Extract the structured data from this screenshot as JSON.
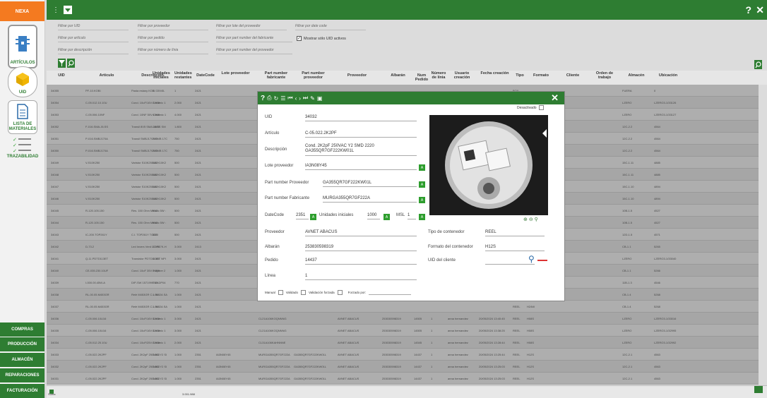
{
  "app": {
    "brand": "NEXA",
    "help": "?",
    "close": "✕"
  },
  "sidebar": {
    "articulos": "ARTÍCULOS",
    "uid": "UID",
    "lista": "LISTA DE MATERIALES",
    "traz": "TRAZABILIDAD",
    "bottom": [
      "COMPRAS",
      "PRODUCCIÓN",
      "ALMACÉN",
      "REPARACIONES",
      "FACTURACIÓN"
    ]
  },
  "filters": {
    "uid": "Filtrar por UID",
    "proveedor": "Filtrar por proveedor",
    "lote": "Filtrar por lote del proveedor",
    "datecode": "Filtrar por date code",
    "articulo": "Filtrar por artículo",
    "pedido": "Filtrar por pedido",
    "pn_fab": "Filtrar por part number del fabricante",
    "mostrar": "Mostrar sólo UID activos",
    "descripcion": "Filtrar por descripción",
    "linea": "Filtrar por número de línia",
    "pn_prov": "Filtrar por part number del proveedor"
  },
  "columns": [
    "UID",
    "Artículo",
    "Descripción",
    "Unidades Iniciales",
    "Unidades restantes",
    "DateCode",
    "Lote proveedor",
    "Part number fabricante",
    "Part number proveedor",
    "Proveedor",
    "Albarán",
    "Num Pedido",
    "Número de línia",
    "Usuario creación",
    "Fecha creación",
    "Tipo",
    "Formato",
    "Cliente",
    "Orden de trabajo",
    "Almacén",
    "Ubicación"
  ],
  "rows": [
    [
      "34055",
      "PF-10.KOBI",
      "Pasta estany KOBI 33945-",
      "1",
      "1",
      "2421",
      "",
      "",
      "",
      "",
      "",
      "",
      "",
      "",
      "",
      "BOX",
      "",
      "",
      "",
      "FUERA",
      "0"
    ],
    [
      "34054",
      "C-05.012.10.10U",
      "Cond. 10uF/16V Cerámic 1",
      "2.000",
      "2.000",
      "2421",
      "",
      "",
      "",
      "",
      "",
      "",
      "",
      "",
      "",
      "REEL",
      "H08S",
      "",
      "",
      "LZERO",
      "LZERO3-1/33126"
    ],
    [
      "34053",
      "C-05.006.10NF",
      "Cond. 10NF 50V Cerámic 1",
      "4.000",
      "4.000",
      "2421",
      "",
      "",
      "",
      "",
      "",
      "",
      "",
      "",
      "",
      "REEL",
      "H08S",
      "",
      "",
      "LZERO",
      "LZERO3-1/33127"
    ],
    [
      "34052",
      "F-016.SMA.J6.SS",
      "Transil 8V5 SMA J6.SS SM",
      "1.800",
      "1.800",
      "2421",
      "",
      "",
      "",
      "",
      "",
      "",
      "",
      "",
      "",
      "REEL",
      "H12S",
      "",
      "",
      "12C-2.2",
      "4564"
    ],
    [
      "34051",
      "P-016.SMBJ170A",
      "Transil SMBJ170A SMB 17C",
      "750",
      "750",
      "2421",
      "",
      "",
      "",
      "",
      "",
      "",
      "",
      "",
      "",
      "REEL",
      "H12W",
      "",
      "",
      "12C-2.2",
      "4564"
    ],
    [
      "34050",
      "P-016.SMBJ170A",
      "Transil SMBJ170A SMB 17C",
      "750",
      "750",
      "2421",
      "",
      "",
      "",
      "",
      "",
      "",
      "",
      "",
      "",
      "REEL",
      "H12W",
      "",
      "",
      "12C-2.2",
      "4564"
    ],
    [
      "34049",
      "V-S10K250",
      "Varistor S10K250 AVX10K2",
      "500",
      "500",
      "2421",
      "",
      "",
      "",
      "",
      "",
      "",
      "",
      "",
      "",
      "BOX",
      "",
      "",
      "",
      "15C-1.11",
      "4885"
    ],
    [
      "34048",
      "V-S10K250",
      "Varistor S10K250 AVX10K2",
      "500",
      "500",
      "2421",
      "",
      "",
      "",
      "",
      "",
      "",
      "",
      "",
      "",
      "BOX",
      "",
      "",
      "",
      "15C-1.11",
      "4885"
    ],
    [
      "34047",
      "V-S10K250",
      "Varistor S10K250 AVX10K2",
      "500",
      "500",
      "2421",
      "",
      "",
      "",
      "",
      "",
      "",
      "",
      "",
      "",
      "BOX",
      "",
      "",
      "",
      "15C-1.10",
      "4894"
    ],
    [
      "34046",
      "V-S10K250",
      "Varistor S10K250 AVX10K2",
      "500",
      "500",
      "2421",
      "",
      "",
      "",
      "",
      "",
      "",
      "",
      "",
      "",
      "BOX",
      "",
      "",
      "",
      "15C-1.10",
      "4894"
    ],
    [
      "34045",
      "R-120.105.150",
      "Res. 150 Ohm Metalic 5W :",
      "500",
      "500",
      "2421",
      "",
      "",
      "",
      "",
      "",
      "",
      "",
      "",
      "",
      "BOX",
      "",
      "",
      "",
      "10B-1.5",
      "4527"
    ],
    [
      "34044",
      "R-120.105.150",
      "Res. 150 Ohm Metalic 5W :",
      "500",
      "500",
      "2421",
      "",
      "",
      "",
      "",
      "",
      "",
      "",
      "",
      "",
      "BOX",
      "",
      "",
      "",
      "10B-1.5",
      "4527"
    ],
    [
      "34043",
      "IC-200.TOP261Y",
      "C.I. TOP261Y TO220",
      "500",
      "500",
      "2421",
      "",
      "",
      "",
      "",
      "",
      "",
      "",
      "",
      "",
      "STICK",
      "",
      "",
      "",
      "12D-1.5",
      "4571"
    ],
    [
      "34042",
      "D-73.2",
      "Led Invers Verd LG P47K-H",
      "3.000",
      "3.000",
      "2413",
      "",
      "",
      "",
      "",
      "",
      "",
      "",
      "",
      "",
      "REEL",
      "H08S",
      "",
      "",
      "CB-1.1",
      "5265"
    ],
    [
      "34041",
      "Q-11.PDTD113ET",
      "Transistor PDTD113ET NPI",
      "3.000",
      "3.000",
      "2421",
      "",
      "",
      "",
      "",
      "",
      "",
      "",
      "",
      "",
      "REEL",
      "H08S",
      "",
      "",
      "LZERO",
      "LZERO3-1/33040"
    ],
    [
      "34040",
      "CE-035.230.10UF",
      "Cond. 10uF 35V Polymer 2",
      "1.000",
      "1.000",
      "2421",
      "",
      "",
      "",
      "",
      "",
      "",
      "",
      "",
      "",
      "REEL",
      "H08S",
      "",
      "",
      "CB-1.1",
      "5266"
    ],
    [
      "34039",
      "I-000.00.45W-A",
      "DIP-SW 1571999-6/ADP04",
      "770",
      "770",
      "2421",
      "",
      "",
      "",
      "",
      "",
      "",
      "",
      "",
      "",
      "STICK",
      "",
      "",
      "",
      "11B-1.3",
      "4546"
    ],
    [
      "34038",
      "RL-00.05.M453GR",
      "Relé M453GR C.I. 5V 2A SA",
      "1.000",
      "1.000",
      "2421",
      "",
      "",
      "",
      "",
      "",
      "",
      "",
      "",
      "",
      "REEL",
      "H24W",
      "",
      "",
      "CB-1.4",
      "5268"
    ],
    [
      "34037",
      "RL-00.05.M453GR",
      "Relé M453GR C.I. 5V 2A SA",
      "1.000",
      "1.000",
      "2421",
      "",
      "",
      "",
      "",
      "",
      "",
      "",
      "",
      "",
      "REEL",
      "H24W",
      "",
      "",
      "CB-1.4",
      "5268"
    ],
    [
      "34036",
      "C-05.006.10U16",
      "Cond. 10uF/16V Cerámic 1",
      "3.000",
      "3.000",
      "2421",
      "",
      "CL21A106KOQNNNG",
      "",
      "AVNET ABACUS",
      "253030598319",
      "14505",
      "1",
      "anna hernandez",
      "20/05/2024 13:40:45",
      "REEL",
      "H08S",
      "",
      "",
      "LZERO",
      "LZERO3-1/33016"
    ],
    [
      "34035",
      "C-05.006.10U16",
      "Cond. 10uF/16V Cerámic 1",
      "3.000",
      "3.000",
      "2421",
      "",
      "CL21A106KOQNNNG",
      "",
      "AVNET ABACUS",
      "253030598319",
      "14505",
      "1",
      "anna hernandez",
      "20/05/2024 13:38:25",
      "REEL",
      "H08S",
      "",
      "",
      "LZERO",
      "LZERO3-1/32995"
    ],
    [
      "34034",
      "C-05.012.25.10U",
      "Cond. 10uF/25V Cerámic 1",
      "2.000",
      "2.000",
      "2421",
      "",
      "CL31A106KAHNNNE",
      "",
      "AVNET ABACUS",
      "253030598319",
      "14545",
      "1",
      "anna hernandez",
      "20/05/2024 13:28:44",
      "REEL",
      "H08S",
      "",
      "",
      "LZERO",
      "LZERO3-1/32992"
    ],
    [
      "34033",
      "C-05.022.2K2PF",
      "Cond. 2K2pF 250VAC Y2 SI",
      "1.000",
      "1.000",
      "2351",
      "IA3N08Y45",
      "MURGA355QR7GF222A",
      "GA355QR7GF222KW01L",
      "AVNET ABACUS",
      "253030598319",
      "14437",
      "1",
      "anna hernandez",
      "20/05/2024 13:25:44",
      "REEL",
      "H12S",
      "",
      "",
      "12C-2.1",
      "4563"
    ],
    [
      "34032",
      "C-05.022.2K2PF",
      "Cond. 2K2pF 250VAC Y2 SI",
      "1.000",
      "1.000",
      "2351",
      "IA3N08Y45",
      "MURGA355QR7GF222A",
      "GA355QR7GF222KW01L",
      "AVNET ABACUS",
      "253030598319",
      "14437",
      "1",
      "anna hernandez",
      "20/05/2024 13:25:03",
      "REEL",
      "H12S",
      "",
      "",
      "12C-2.1",
      "4563"
    ],
    [
      "34031",
      "C-05.022.2K2PF",
      "Cond. 2K2pF 250VAC Y2 SI",
      "1.000",
      "1.000",
      "2351",
      "IA3N08Y45",
      "MURGA355QR7GF222A",
      "GA355QR7GF222KW01L",
      "AVNET ABACUS",
      "253030598319",
      "14437",
      "1",
      "anna hernandez",
      "20/05/2024 13:25:03",
      "REEL",
      "H12S",
      "",
      "",
      "12C-2.1",
      "4563"
    ],
    [
      "34030",
      "CN-500.006.06/Q.ST",
      "Conector 06/Q.ST (ST 6 pi",
      "500",
      "500",
      "2421",
      "",
      "06/Q.ST",
      "",
      "JST ESPAÑOL S.A.",
      "A1/132.829",
      "14517",
      "9",
      "anna hernandez",
      "20/05/2024 13:20:17",
      "BOX",
      "",
      "",
      "",
      "16A-1.4",
      "5276"
    ]
  ],
  "modal": {
    "desactivado": "Desactivado",
    "uid_label": "UID",
    "uid": "34032",
    "articulo_label": "Artículo",
    "articulo": "C-05.022.2K2PF",
    "descripcion_label": "Descripción",
    "descripcion": "Cond. 2K2pF 250VAC Y2 SMD 2220 GA355QR7GF222KW01L",
    "lote_label": "Lote proveedor",
    "lote": "IA3N08Y45",
    "pnprov_label": "Part number Proveedor",
    "pnprov": "GA355QR7GF222KW01L",
    "pnfab_label": "Part number Fabricante",
    "pnfab": "MURGA355QR7GF222A",
    "datecode_label": "DateCode",
    "datecode": "2351",
    "uinic_label": "Unidades iniciales",
    "uinic": "1000",
    "msl_label": "MSL",
    "msl": "1",
    "proveedor_label": "Proveedor",
    "proveedor": "AVNET ABACUS",
    "albaran_label": "Albarán",
    "albaran": "253830598319",
    "pedido_label": "Pedido",
    "pedido": "14437",
    "linea_label": "Línea",
    "linea": "1",
    "tipo_label": "Tipo de contenedor",
    "tipo": "REEL",
    "formato_label": "Formato del contenedor",
    "formato": "H12S",
    "uidcli_label": "UID del cliente",
    "manual": "Manual",
    "validado": "Validado",
    "forzada": "Validación forzada",
    "forzado_por": "Forzado por:",
    "A": "A"
  },
  "footer": {
    "suma": "Suma",
    "total": "3.001.988"
  }
}
